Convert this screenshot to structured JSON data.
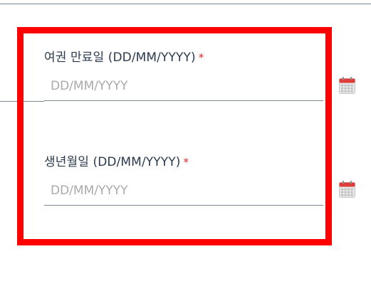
{
  "form": {
    "passport_expiry": {
      "label": "여권 만료일 (DD/MM/YYYY)",
      "required_mark": "*",
      "value": "",
      "placeholder": "DD/MM/YYYY",
      "icon": "calendar-icon"
    },
    "date_of_birth": {
      "label": "생년월일 (DD/MM/YYYY)",
      "required_mark": "*",
      "value": "",
      "placeholder": "DD/MM/YYYY",
      "icon": "calendar-icon"
    }
  },
  "colors": {
    "highlight": "#ff0000",
    "label_text": "#2a3a4f",
    "required": "#e0262b",
    "placeholder": "#a9a9a9",
    "underline": "#7a8795",
    "calendar_header": "#e03b36",
    "calendar_body": "#d9d9d9"
  }
}
